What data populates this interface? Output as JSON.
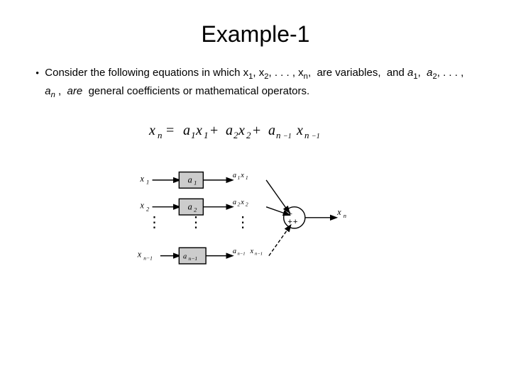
{
  "title": "Example-1",
  "bullet": {
    "prefix": "Consider the following equations in which ",
    "vars": "x₁, x₂, . . . , xₙ,",
    "middle": " are variables, and ",
    "coeffs": "a₁, a₂, . . . , aₙ ,",
    "are": " are ",
    "are_italic": "are",
    "suffix": " general coefficients or mathematical operators."
  },
  "equation": "xₙ = a₁x₁ + a₂x₂ + aₙ₋₁xₙ₋₁",
  "diagram_alt": "Block diagram showing weighted sum network"
}
